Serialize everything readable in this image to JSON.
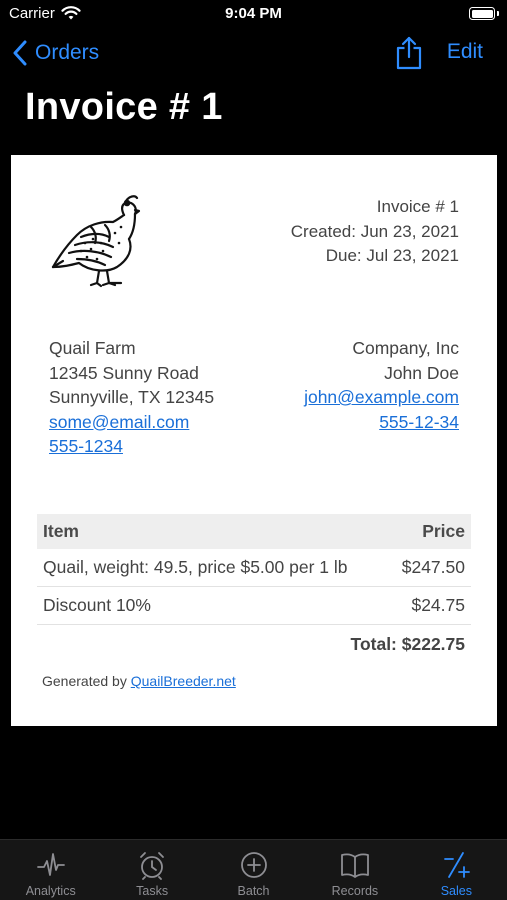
{
  "status_bar": {
    "carrier": "Carrier",
    "time": "9:04 PM"
  },
  "nav": {
    "back_label": "Orders",
    "edit_label": "Edit",
    "title": "Invoice # 1"
  },
  "invoice": {
    "meta": [
      "Invoice # 1",
      "Created: Jun 23, 2021",
      "Due: Jul 23, 2021"
    ],
    "seller": {
      "name": "Quail Farm",
      "address1": "12345 Sunny Road",
      "address2": "Sunnyville, TX 12345",
      "email": "some@email.com",
      "phone": "555-1234"
    },
    "buyer": {
      "company": "Company, Inc",
      "contact": "John Doe",
      "email": "john@example.com",
      "phone": "555-12-34"
    },
    "table": {
      "headers": {
        "item": "Item",
        "price": "Price"
      },
      "rows": [
        {
          "item": "Quail, weight: 49.5, price $5.00 per 1 lb",
          "price": "$247.50"
        },
        {
          "item": "Discount 10%",
          "price": "$24.75"
        }
      ],
      "total": "Total: $222.75"
    },
    "footer": {
      "prefix": "Generated by ",
      "link": "QuailBreeder.net"
    }
  },
  "tabs": [
    {
      "label": "Analytics",
      "icon": "waveform-icon"
    },
    {
      "label": "Tasks",
      "icon": "alarm-icon"
    },
    {
      "label": "Batch",
      "icon": "plus-circle-icon"
    },
    {
      "label": "Records",
      "icon": "book-icon"
    },
    {
      "label": "Sales",
      "icon": "plus-slash-minus-icon",
      "active": true
    }
  ],
  "colors": {
    "accent": "#2f8dff",
    "link": "#1a6fd8",
    "background": "#000000",
    "tab_bar": "#161616"
  }
}
